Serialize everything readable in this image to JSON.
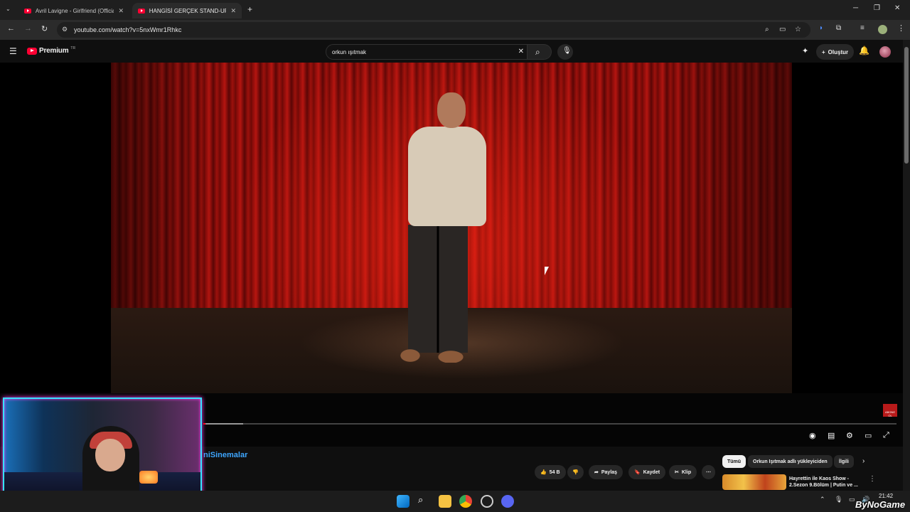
{
  "browser": {
    "tabs": [
      {
        "title": "Avril Lavigne - Girlfriend (Official",
        "active": false
      },
      {
        "title": "HANGİSİ GERÇEK STAND-UP K",
        "active": true
      }
    ],
    "new_tab": "+",
    "url": "youtube.com/watch?v=5nxWmr1Rhkc"
  },
  "youtube": {
    "logo_text": "Premium",
    "logo_region": "TR",
    "search_query": "orkun ışıtmak",
    "create_label": "Oluştur"
  },
  "video": {
    "progress_played": 0.003,
    "progress_buffered": 0.057,
    "subscribe_badge": "ABONE OL"
  },
  "below": {
    "channel_name": "niSinemalar",
    "likes": "54 B",
    "share_label": "Paylaş",
    "save_label": "Kaydet",
    "clip_label": "Klip",
    "chips": [
      "Tümü",
      "Orkun Işıtmak adlı yükleyiciden",
      "İlgili"
    ],
    "recommendation_title": "Hayrettin ile Kaos Show - 2.Sezon 9.Bölüm | Putin ve ..."
  },
  "taskbar": {
    "time": "21:42"
  },
  "watermark": "ByNoGame",
  "colors": {
    "accent_red": "#ff0033",
    "link_blue": "#3ea6ff",
    "cam_border": "#35e4ff"
  }
}
